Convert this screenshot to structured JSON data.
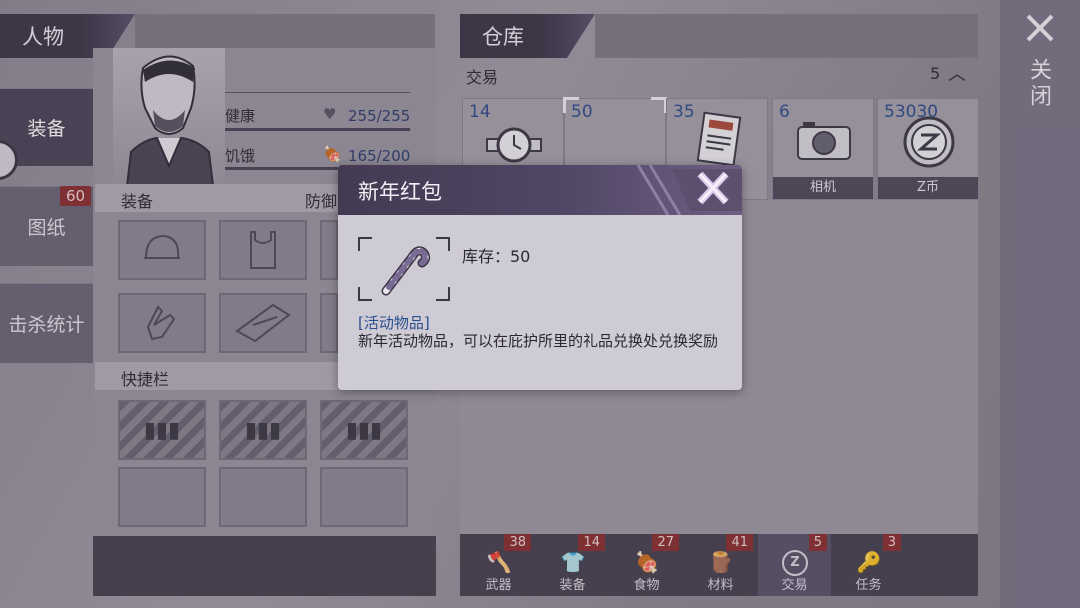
{
  "character": {
    "title": "人物",
    "tabs": [
      {
        "label": "装备",
        "selected": true
      },
      {
        "label": "图纸",
        "badge": "60"
      },
      {
        "label": "击杀统计"
      }
    ],
    "stats": {
      "health_label": "健康",
      "health_value": "255/255",
      "hunger_label": "饥饿",
      "hunger_value": "165/200"
    },
    "equip_label": "装备",
    "defense_label": "防御",
    "quickbar_label": "快捷栏"
  },
  "warehouse": {
    "title": "仓库",
    "trade_label": "交易",
    "trade_count": "5",
    "items": [
      {
        "count": "14",
        "label": "",
        "icon": "watch-icon"
      },
      {
        "count": "50",
        "label": "",
        "icon": "empty"
      },
      {
        "count": "35",
        "label": "",
        "icon": "newspaper-icon"
      },
      {
        "count": "6",
        "label": "相机",
        "icon": "camera-icon"
      },
      {
        "count": "53030",
        "label": "Z币",
        "icon": "z-coin-icon"
      }
    ],
    "bottom_tabs": [
      {
        "label": "武器",
        "badge": "38"
      },
      {
        "label": "装备",
        "badge": "14"
      },
      {
        "label": "食物",
        "badge": "27"
      },
      {
        "label": "材料",
        "badge": "41"
      },
      {
        "label": "交易",
        "badge": "5"
      },
      {
        "label": "任务",
        "badge": "3"
      }
    ]
  },
  "close_label": "关闭",
  "popup": {
    "title": "新年红包",
    "stock_text": "库存：50",
    "category": "[活动物品]",
    "description": "新年活动物品，可以在庇护所里的礼品兑换处兑换奖励"
  }
}
